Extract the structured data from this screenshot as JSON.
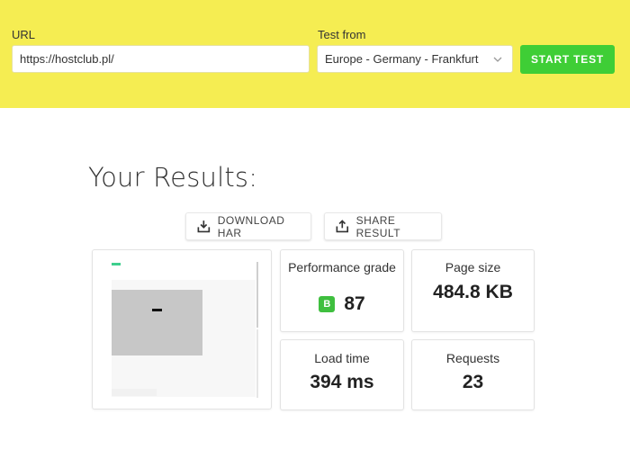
{
  "form": {
    "url_label": "URL",
    "url_value": "https://hostclub.pl/",
    "test_from_label": "Test from",
    "test_from_value": "Europe - Germany - Frankfurt",
    "start_label": "START TEST"
  },
  "results": {
    "title": "Your Results:",
    "download_label": "DOWNLOAD HAR",
    "share_label": "SHARE RESULT"
  },
  "metrics": {
    "performance": {
      "label": "Performance grade",
      "grade": "B",
      "value": "87"
    },
    "page_size": {
      "label": "Page size",
      "value": "484.8 KB"
    },
    "load_time": {
      "label": "Load time",
      "value": "394 ms"
    },
    "requests": {
      "label": "Requests",
      "value": "23"
    }
  },
  "colors": {
    "band": "#f5ed52",
    "start_button": "#3fce36",
    "grade_badge": "#3fbf3f"
  },
  "icons": {
    "download": "download-icon",
    "share": "share-icon",
    "select": "chevron-down-icon"
  }
}
